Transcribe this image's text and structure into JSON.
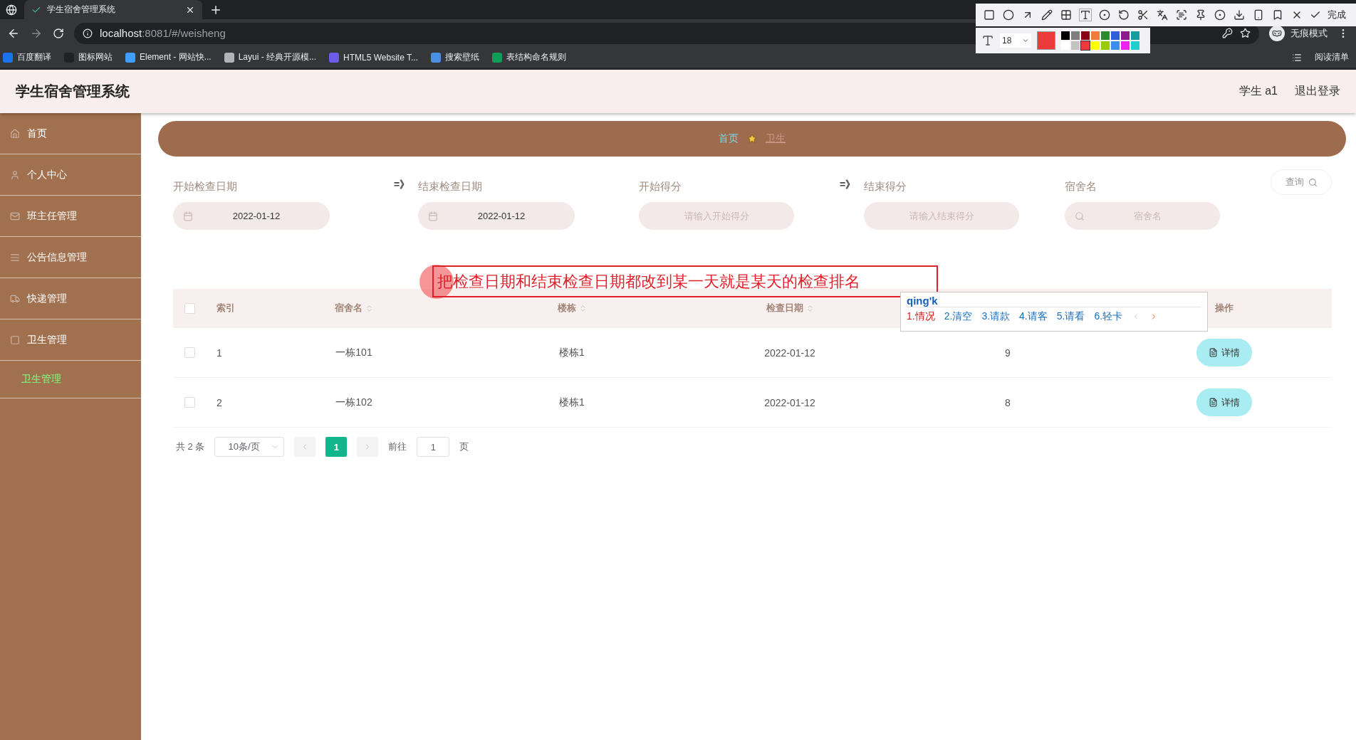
{
  "browser": {
    "tab_title": "学生宿舍管理系统",
    "url_host": "localhost",
    "url_rest": ":8081/#/weisheng",
    "bookmarks": [
      {
        "label": "百度翻译",
        "color": "#1a73e8"
      },
      {
        "label": "图标网站",
        "color": "#202124"
      },
      {
        "label": "Element - 网站快...",
        "color": "#409eff"
      },
      {
        "label": "Layui - 经典开源模...",
        "color": "#b0b3b8"
      },
      {
        "label": "HTML5 Website T...",
        "color": "#6c5ce7"
      },
      {
        "label": "搜索壁纸",
        "color": "#4a90e2"
      },
      {
        "label": "表结构命名规则",
        "color": "#0f9d58"
      }
    ],
    "profile": "无痕模式",
    "reading_list": "阅读清单"
  },
  "capture_toolbar": {
    "done": "完成",
    "font_size": "18",
    "swatches": [
      {
        "color": "#000000",
        "selected": false
      },
      {
        "color": "#7f7f7f",
        "selected": false
      },
      {
        "color": "#880015",
        "selected": false
      },
      {
        "color": "#f07c3c",
        "selected": false
      },
      {
        "color": "#2d8a2d",
        "selected": false
      },
      {
        "color": "#2f5fd8",
        "selected": false
      },
      {
        "color": "#8b1a8b",
        "selected": false
      },
      {
        "color": "#159c9c",
        "selected": false
      },
      {
        "color": "#ffffff",
        "selected": false
      },
      {
        "color": "#c3c3c3",
        "selected": false
      },
      {
        "color": "#ed3b3b",
        "selected": true
      },
      {
        "color": "#ffff00",
        "selected": false
      },
      {
        "color": "#99cc00",
        "selected": false
      },
      {
        "color": "#3d8ee8",
        "selected": false
      },
      {
        "color": "#ee22ee",
        "selected": false
      },
      {
        "color": "#22cccc",
        "selected": false
      }
    ]
  },
  "app": {
    "title": "学生宿舍管理系统",
    "user": "学生 a1",
    "logout": "退出登录"
  },
  "sidebar": {
    "items": [
      {
        "label": "首页"
      },
      {
        "label": "个人中心"
      },
      {
        "label": "班主任管理"
      },
      {
        "label": "公告信息管理"
      },
      {
        "label": "快递管理"
      },
      {
        "label": "卫生管理",
        "children": [
          {
            "label": "卫生管理",
            "selected": true
          }
        ]
      }
    ]
  },
  "breadcrumb": [
    "首页",
    "卫生"
  ],
  "filters": [
    {
      "kind": "date",
      "label": "开始检查日期",
      "value": "2022-01-12",
      "arrow_after": "=》"
    },
    {
      "kind": "date",
      "label": "结束检查日期",
      "value": "2022-01-12"
    },
    {
      "kind": "number",
      "label": "开始得分",
      "placeholder": "请输入开始得分",
      "arrow_after": "=》"
    },
    {
      "kind": "number",
      "label": "结束得分",
      "placeholder": "请输入结束得分"
    },
    {
      "kind": "search",
      "label": "宿舍名",
      "placeholder": "宿舍名"
    }
  ],
  "query_button": "查询",
  "table": {
    "all_checked": false,
    "columns": [
      {
        "label": "索引",
        "sortable": false
      },
      {
        "label": "宿舍名",
        "sortable": true
      },
      {
        "label": "楼栋",
        "sortable": true
      },
      {
        "label": "检查日期",
        "sortable": true
      },
      {
        "label": "操作",
        "sortable": false
      }
    ],
    "rows": [
      {
        "checked": false,
        "index": "1",
        "dorm": "一栋101",
        "building": "楼栋1",
        "date": "2022-01-12",
        "score": "9",
        "action": "详情"
      },
      {
        "checked": false,
        "index": "2",
        "dorm": "一栋102",
        "building": "楼栋1",
        "date": "2022-01-12",
        "score": "8",
        "action": "详情"
      }
    ]
  },
  "pagination": {
    "total": "共 2 条",
    "page_size": "10条/页",
    "pages": [
      {
        "label": "1",
        "selected": true
      }
    ],
    "goto_label": "前往",
    "goto_value": "1",
    "page_suffix": "页"
  },
  "annotation": {
    "text": "把检查日期和结束检查日期都改到某一天就是某天的检查排名"
  },
  "ime": {
    "input": "qing'k",
    "candidates": [
      {
        "label": "1.情况",
        "selected": true
      },
      {
        "label": "2.清空",
        "selected": false
      },
      {
        "label": "3.请款",
        "selected": false
      },
      {
        "label": "4.请客",
        "selected": false
      },
      {
        "label": "5.请看",
        "selected": false
      },
      {
        "label": "6.轻卡",
        "selected": false
      }
    ]
  }
}
